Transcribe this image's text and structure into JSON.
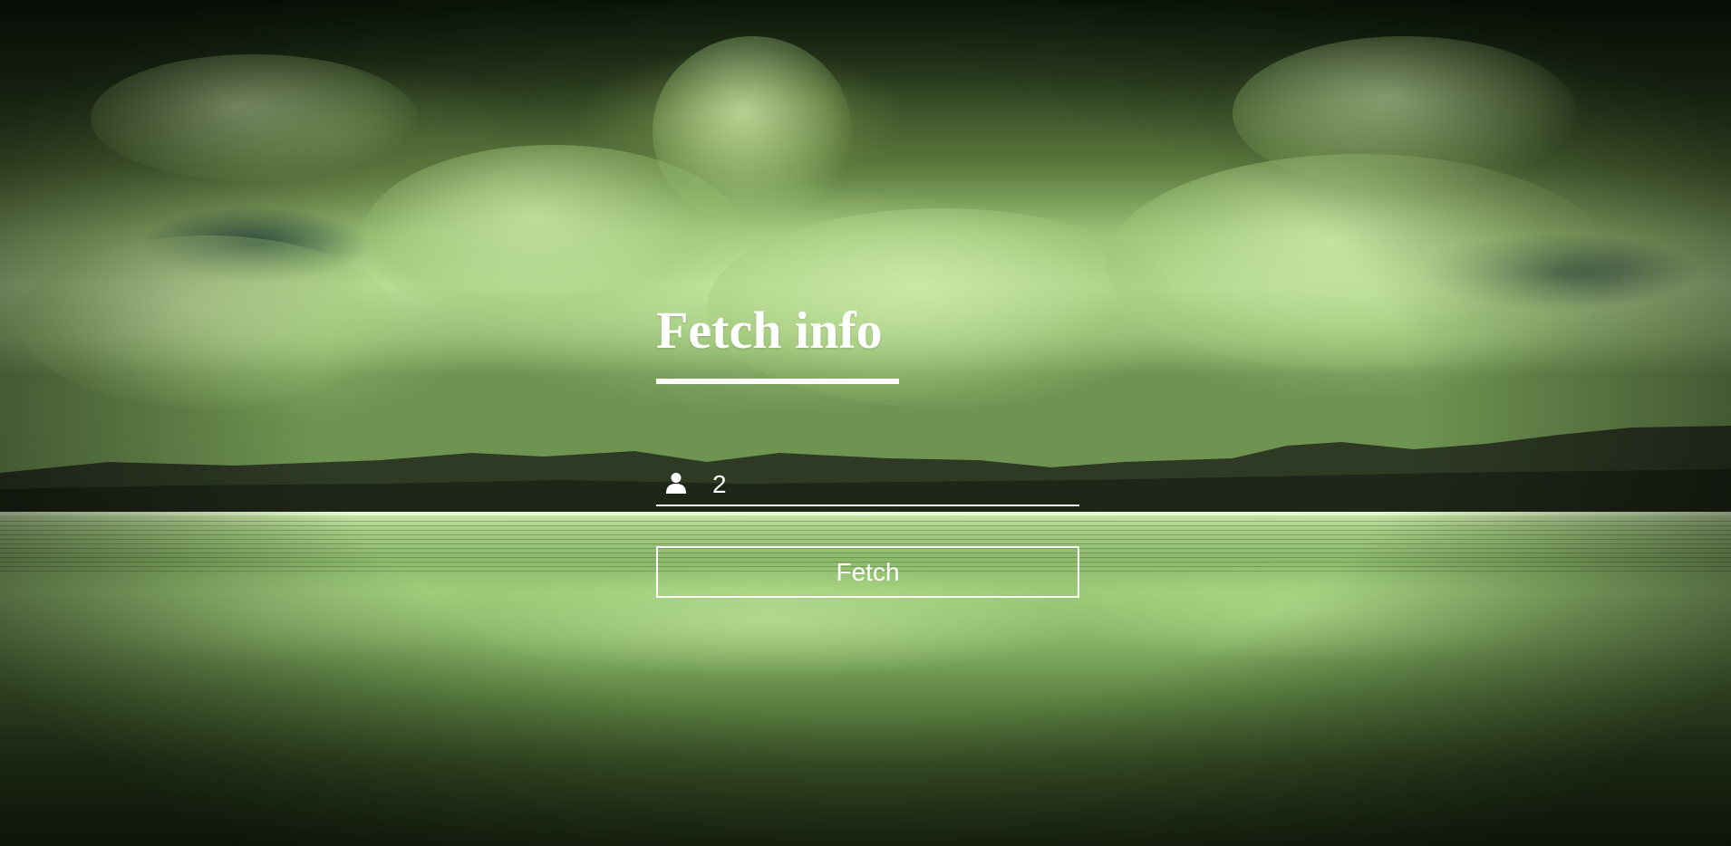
{
  "page": {
    "title": "Fetch info"
  },
  "form": {
    "id_input": {
      "value": "2",
      "icon": "user-icon"
    },
    "fetch_button_label": "Fetch"
  },
  "colors": {
    "text": "#ffffff",
    "underline": "#ffffff",
    "button_border": "#ffffff"
  }
}
